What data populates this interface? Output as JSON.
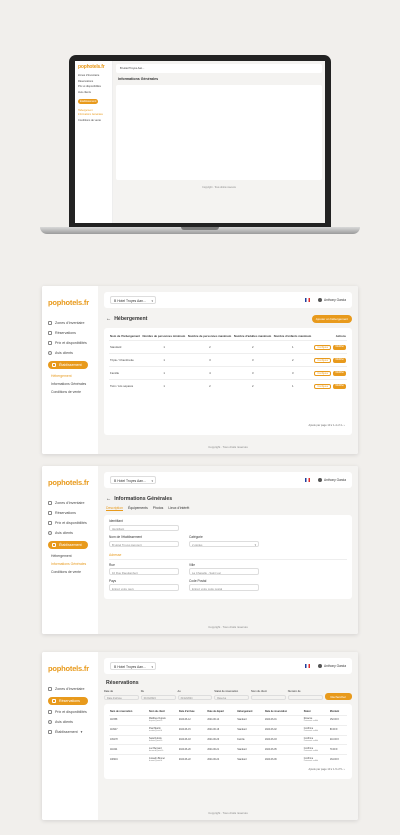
{
  "brand": "pophotels.fr",
  "hotel_select": "B Hotel Troyes Aan...",
  "user": "Anthony Garcia",
  "copyright": "Copyright · Tous droits réservés",
  "nav": {
    "zones": "Zones d'Inventaire",
    "reservations": "Réservations",
    "prix": "Prix et disponibilités",
    "avis": "Avis clients",
    "etablissement": "Établissement",
    "hebergement": "Hébergement",
    "infos": "Informations Générales",
    "conditions": "Conditions de vente"
  },
  "laptop": {
    "title": "Informations Générales"
  },
  "hebergement": {
    "title": "Hébergement",
    "add_button": "Ajouter un hébergement",
    "columns": [
      "Nom de l'hébergement",
      "Nombre de personnes minimum",
      "Nombre de personnes maximum",
      "Nombre d'adultes maximum",
      "Nombre d'enfants maximum",
      "Actions"
    ],
    "rows": [
      {
        "name": "Standard",
        "min": "1",
        "max": "2",
        "adults": "2",
        "children": "1"
      },
      {
        "name": "Triple / Chambrette",
        "min": "1",
        "max": "3",
        "adults": "3",
        "children": "2"
      },
      {
        "name": "Famille",
        "min": "1",
        "max": "4",
        "adults": "3",
        "children": "3"
      },
      {
        "name": "Twin / Lits séparés",
        "min": "1",
        "max": "2",
        "adults": "2",
        "children": "1"
      }
    ],
    "action_edit": "Configurer",
    "action_main": "Modifier",
    "pager": "Ajouts par page 10 ▾   1-4 of 4   ‹  ›"
  },
  "infos": {
    "title": "Informations Générales",
    "tabs": [
      "Description",
      "Équipements",
      "Photos",
      "Lieux d'intérêt"
    ],
    "identifiant_label": "Identifiant",
    "identifiant_value": "Identifiant",
    "nom_label": "Nom de l'établissement",
    "nom_value": "B Hotel Troyes Aeroport",
    "categorie_label": "Catégorie",
    "categorie_value": "2 étoiles",
    "adresse_label": "Adresse",
    "rue_label": "Rue",
    "rue_value": "10 Rue Raoulambert",
    "ville_label": "Ville",
    "ville_value": "La Chapelle - Saint Luc",
    "pays_label": "Pays",
    "pays_value": "Entrez votre pays",
    "cp_label": "Code Postal",
    "cp_value": "Entrez votre code postal"
  },
  "reservations": {
    "title": "Réservations",
    "filters": [
      {
        "label": "Date de",
        "value": "Date d'arrivée"
      },
      {
        "label": "Du",
        "value": "01/01/2024"
      },
      {
        "label": "Au",
        "value": "31/12/2024"
      },
      {
        "label": "Statut de réservation",
        "value": "Réservé"
      },
      {
        "label": "Nom du client",
        "value": ""
      },
      {
        "label": "Numéro de",
        "value": ""
      }
    ],
    "ok_button": "Rechercher",
    "columns": [
      "Num de réservation",
      "Nom du client",
      "Date d'arrivée",
      "Date de départ",
      "Hébergement",
      "Date de réservation",
      "Statut",
      "Montant"
    ],
    "rows": [
      {
        "num": "111558",
        "client": "Matthieu Dupuis",
        "email": "dupuis@mail.fr",
        "arr": "2024-06-12",
        "dep": "2024-06-14",
        "heb": "Standard",
        "date": "2024-06-01",
        "status": "Réservé",
        "status2": "Paiement validé",
        "amount": "152.00 €"
      },
      {
        "num": "110947",
        "client": "Paul Martin",
        "email": "martin@mail.fr",
        "arr": "2024-06-15",
        "dep": "2024-06-16",
        "heb": "Standard",
        "date": "2024-06-02",
        "status": "Confirmé",
        "status2": "Paiement validé",
        "amount": "89.00 €"
      },
      {
        "num": "109178",
        "client": "Sara Dubois",
        "email": "dubois@mail.fr",
        "arr": "2024-06-18",
        "dep": "2024-06-20",
        "heb": "Famille",
        "date": "2024-06-03",
        "status": "Confirmé",
        "status2": "Paiement validé",
        "amount": "210.00 €"
      },
      {
        "num": "111624",
        "client": "Luc Bernard",
        "email": "bernard@mail.fr",
        "arr": "2024-06-20",
        "dep": "2024-06-21",
        "heb": "Standard",
        "date": "2024-06-05",
        "status": "Confirmé",
        "status2": "Paiement validé",
        "amount": "79.00 €"
      },
      {
        "num": "108219",
        "client": "Josselin Brunet",
        "email": "brunet@mail.fr",
        "arr": "2024-06-22",
        "dep": "2024-06-24",
        "heb": "Standard",
        "date": "2024-06-06",
        "status": "Confirmé",
        "status2": "Paiement validé",
        "amount": "164.00 €"
      }
    ],
    "pager": "Ajouts par page 10 ▾   1-5 of 5   ‹  ›"
  },
  "colors": {
    "accent": "#e89a1c",
    "background": "#f1efec"
  }
}
